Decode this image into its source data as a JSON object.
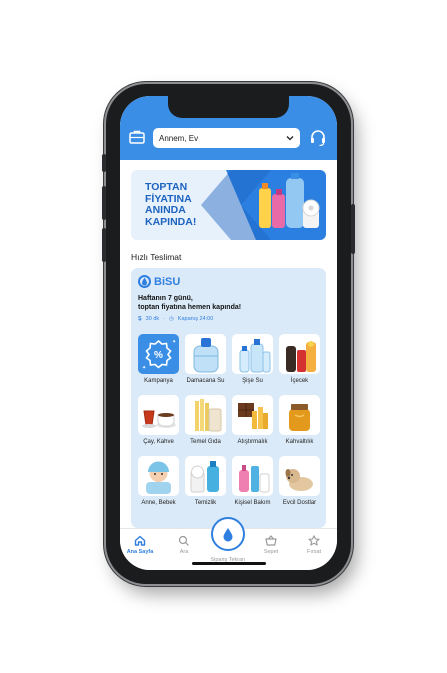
{
  "header": {
    "address_label": "Annem, Ev",
    "bag_icon": "briefcase-icon",
    "support_icon": "headset-icon",
    "accent": "#3a8ee6"
  },
  "banner": {
    "line1": "TOPTAN",
    "line2": "FİYATINA",
    "line3": "ANINDA",
    "line4": "KAPINDA!"
  },
  "section": {
    "title": "Hızlı Teslimat"
  },
  "store": {
    "brand": "BiSU",
    "tagline_line1": "Haftanın 7 günü,",
    "tagline_line2": "toptan fiyatına hemen kapında!",
    "delivery_time": "30 dk",
    "closing": "Kapanış 24:00",
    "categories": [
      {
        "label": "Kampanya"
      },
      {
        "label": "Damacana Su"
      },
      {
        "label": "Şişe Su"
      },
      {
        "label": "İçecek"
      },
      {
        "label": "Çay, Kahve"
      },
      {
        "label": "Temel Gıda"
      },
      {
        "label": "Atıştırmalık"
      },
      {
        "label": "Kahvaltılık"
      },
      {
        "label": "Anne, Bebek"
      },
      {
        "label": "Temizlik"
      },
      {
        "label": "Kişisel Bakım"
      },
      {
        "label": "Evcil Dostlar"
      }
    ]
  },
  "tabs": [
    {
      "label": "Ana Sayfa",
      "icon": "home-icon"
    },
    {
      "label": "Ara",
      "icon": "search-icon"
    },
    {
      "label": "Sipariş Tekrarı",
      "icon": "water-drop-icon"
    },
    {
      "label": "Sepet",
      "icon": "basket-icon"
    },
    {
      "label": "Fırsat",
      "icon": "star-icon"
    }
  ]
}
